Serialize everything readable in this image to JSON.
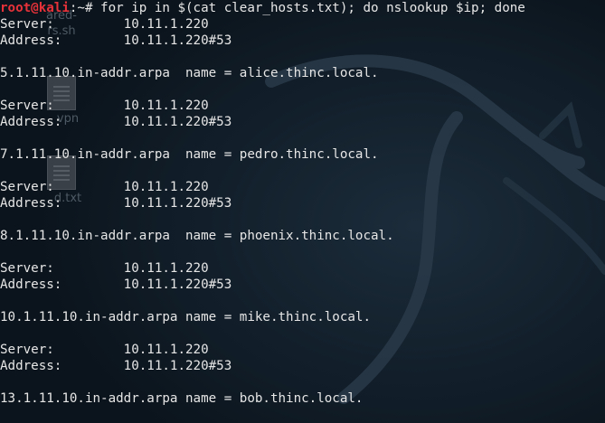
{
  "window": {
    "kind": "terminal"
  },
  "desktop": {
    "icons": [
      {
        "label": "shared-users.sh",
        "lines": [
          "ared-",
          "rs.sh"
        ]
      },
      {
        "label": "vpn",
        "lines": [
          "vpn"
        ]
      },
      {
        "label": "d.txt",
        "lines": [
          "d.txt"
        ]
      }
    ],
    "logo": "kali-dragon-icon"
  },
  "terminal": {
    "prompt_user": "root@kali",
    "prompt_path": ":~# ",
    "command": "for ip in $(cat clear_hosts.txt); do nslookup $ip; done",
    "output_lines": [
      "Server:         10.11.1.220",
      "Address:        10.11.1.220#53",
      "",
      "5.1.11.10.in-addr.arpa  name = alice.thinc.local.",
      "",
      "Server:         10.11.1.220",
      "Address:        10.11.1.220#53",
      "",
      "7.1.11.10.in-addr.arpa  name = pedro.thinc.local.",
      "",
      "Server:         10.11.1.220",
      "Address:        10.11.1.220#53",
      "",
      "8.1.11.10.in-addr.arpa  name = phoenix.thinc.local.",
      "",
      "Server:         10.11.1.220",
      "Address:        10.11.1.220#53",
      "",
      "10.1.11.10.in-addr.arpa name = mike.thinc.local.",
      "",
      "Server:         10.11.1.220",
      "Address:        10.11.1.220#53",
      "",
      "13.1.11.10.in-addr.arpa name = bob.thinc.local."
    ]
  },
  "colors": {
    "background": "#0e1822",
    "text": "#e6e6e6",
    "prompt_user": "#e8323a"
  }
}
